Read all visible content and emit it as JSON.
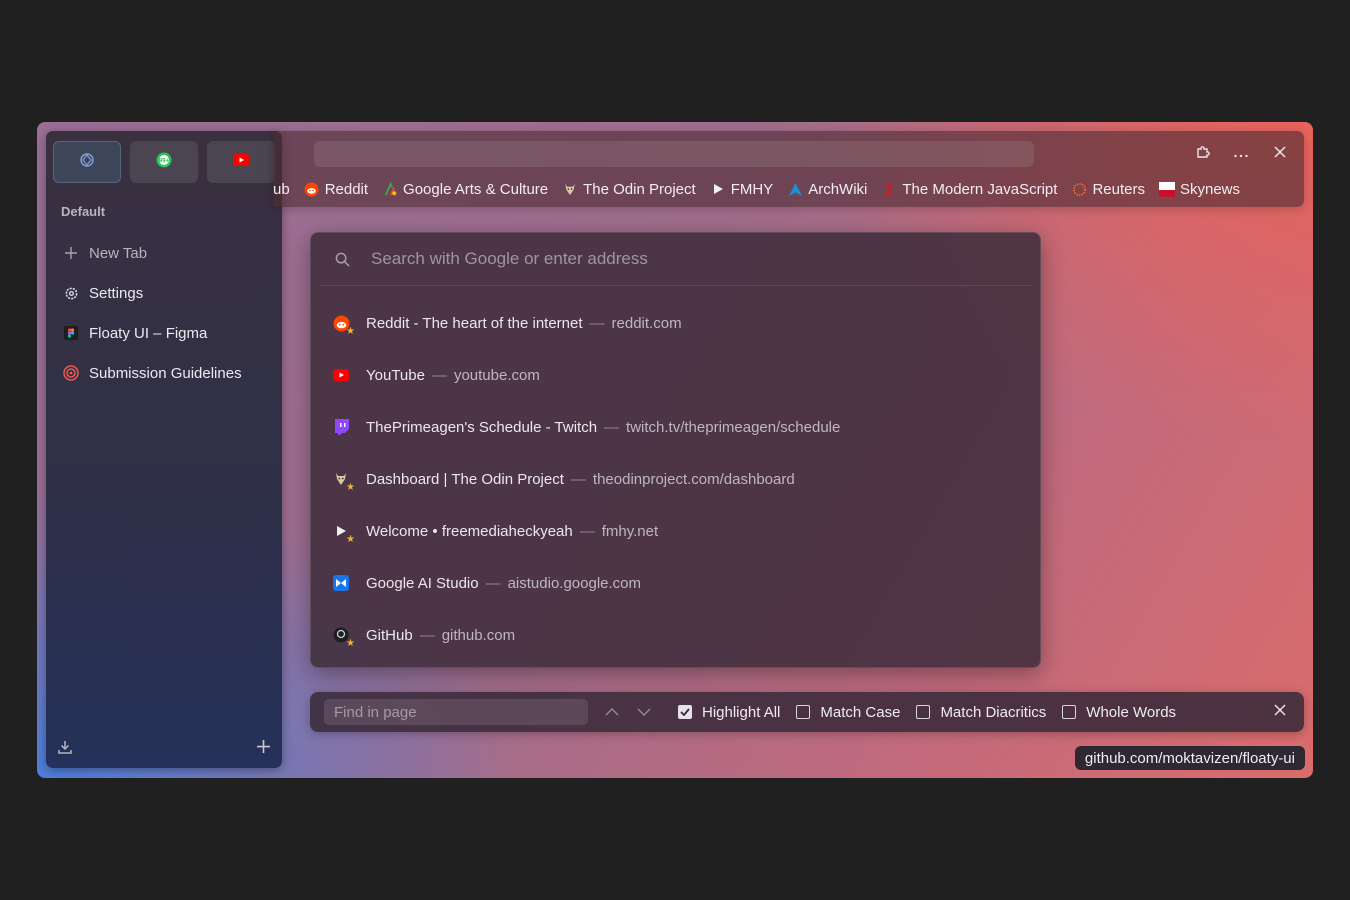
{
  "sidebar": {
    "pinned": [
      {
        "name": "browser-icon"
      },
      {
        "name": "whatsapp-icon",
        "badge": "99+"
      },
      {
        "name": "youtube-icon"
      }
    ],
    "workspace_label": "Default",
    "new_tab_label": "New Tab",
    "tabs": [
      {
        "label": "Settings",
        "icon": "gear-icon"
      },
      {
        "label": "Floaty UI – Figma",
        "icon": "figma-icon"
      },
      {
        "label": "Submission Guidelines",
        "icon": "target-icon"
      }
    ]
  },
  "topbar": {
    "url_value": "",
    "bookmarks": [
      {
        "label": "ub",
        "icon": "github-icon"
      },
      {
        "label": "Reddit",
        "icon": "reddit-icon"
      },
      {
        "label": "Google Arts & Culture",
        "icon": "google-arts-icon"
      },
      {
        "label": "The Odin Project",
        "icon": "odin-icon"
      },
      {
        "label": "FMHY",
        "icon": "play-icon"
      },
      {
        "label": "ArchWiki",
        "icon": "arch-icon"
      },
      {
        "label": "The Modern JavaScript",
        "icon": "js-icon"
      },
      {
        "label": "Reuters",
        "icon": "reuters-icon"
      },
      {
        "label": "Skynews",
        "icon": "skynews-icon"
      }
    ]
  },
  "dropdown": {
    "placeholder": "Search with Google or enter address",
    "results": [
      {
        "title": "Reddit - The heart of the internet",
        "url": "reddit.com",
        "icon": "reddit-icon",
        "bookmarked": true
      },
      {
        "title": "YouTube",
        "url": "youtube.com",
        "icon": "youtube-icon",
        "bookmarked": false
      },
      {
        "title": "ThePrimeagen's Schedule - Twitch",
        "url": "twitch.tv/theprimeagen/schedule",
        "icon": "twitch-icon",
        "bookmarked": false
      },
      {
        "title": "Dashboard | The Odin Project",
        "url": "theodinproject.com/dashboard",
        "icon": "odin-icon",
        "bookmarked": true
      },
      {
        "title": "Welcome • freemediaheckyeah",
        "url": "fmhy.net",
        "icon": "play-icon",
        "bookmarked": true
      },
      {
        "title": "Google AI Studio",
        "url": "aistudio.google.com",
        "icon": "ai-studio-icon",
        "bookmarked": false
      },
      {
        "title": "GitHub",
        "url": "github.com",
        "icon": "github-icon",
        "bookmarked": true
      }
    ],
    "separator": "—"
  },
  "findbar": {
    "placeholder": "Find in page",
    "options": [
      {
        "label": "Highlight All",
        "checked": true
      },
      {
        "label": "Match Case",
        "checked": false
      },
      {
        "label": "Match Diacritics",
        "checked": false
      },
      {
        "label": "Whole Words",
        "checked": false
      }
    ]
  },
  "status_url": "github.com/moktavizen/floaty-ui",
  "colors": {
    "accent_red": "#e8635a",
    "accent_blue": "#4d7fdc",
    "youtube": "#ff0000",
    "reddit": "#ff4500"
  }
}
